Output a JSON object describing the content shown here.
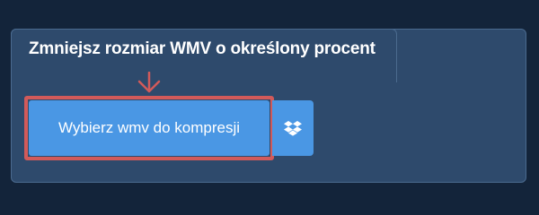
{
  "converter": {
    "title": "Zmniejsz rozmiar WMV o określony procent",
    "upload_button_label": "Wybierz wmv do kompresji",
    "dropbox_icon": "dropbox-icon",
    "arrow_icon": "arrow-down-icon"
  },
  "colors": {
    "background": "#13243a",
    "panel": "#2e4a6c",
    "button": "#4a97e4",
    "highlight": "#d25a5a"
  }
}
